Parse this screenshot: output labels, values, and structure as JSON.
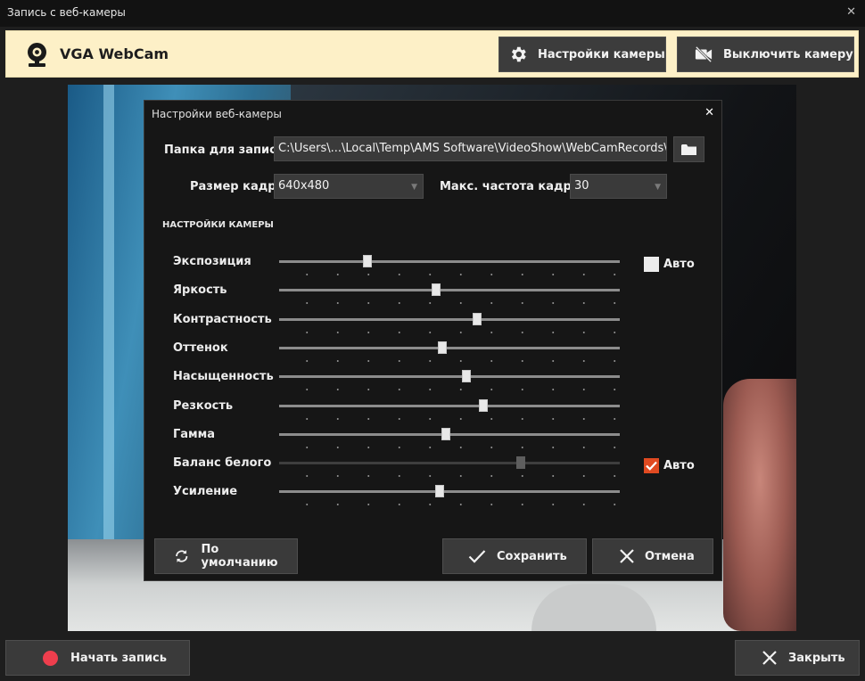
{
  "window": {
    "title": "Запись с веб-камеры"
  },
  "camera_bar": {
    "device_name": "VGA WebCam",
    "settings_button": "Настройки камеры",
    "disable_button": "Выключить камеру"
  },
  "dialog": {
    "title": "Настройки веб-камеры",
    "folder_label": "Папка для записи",
    "folder_value": "C:\\Users\\...\\Local\\Temp\\AMS Software\\VideoShow\\WebCamRecords\\",
    "frame_size_label": "Размер кадра",
    "frame_size_value": "640x480",
    "fps_label": "Макс. частота кадров",
    "fps_value": "30",
    "section_title": "НАСТРОЙКИ КАМЕРЫ",
    "auto_label": "Авто",
    "sliders": [
      {
        "label": "Экспозиция",
        "value": 0.26,
        "auto": "unchecked",
        "enabled": true
      },
      {
        "label": "Яркость",
        "value": 0.46,
        "enabled": true
      },
      {
        "label": "Контрастность",
        "value": 0.58,
        "enabled": true
      },
      {
        "label": "Оттенок",
        "value": 0.48,
        "enabled": true
      },
      {
        "label": "Насыщенность",
        "value": 0.55,
        "enabled": true
      },
      {
        "label": "Резкость",
        "value": 0.6,
        "enabled": true
      },
      {
        "label": "Гамма",
        "value": 0.49,
        "enabled": true
      },
      {
        "label": "Баланс белого",
        "value": 0.71,
        "auto": "checked",
        "enabled": false
      },
      {
        "label": "Усиление",
        "value": 0.47,
        "enabled": true
      }
    ],
    "default_button": "По умолчанию",
    "save_button": "Сохранить",
    "cancel_button": "Отмена"
  },
  "footer": {
    "record_button": "Начать запись",
    "close_button": "Закрыть"
  },
  "colors": {
    "accent": "#e04a21",
    "record": "#ee3e4d",
    "camera_bar": "#fdf0c7"
  }
}
